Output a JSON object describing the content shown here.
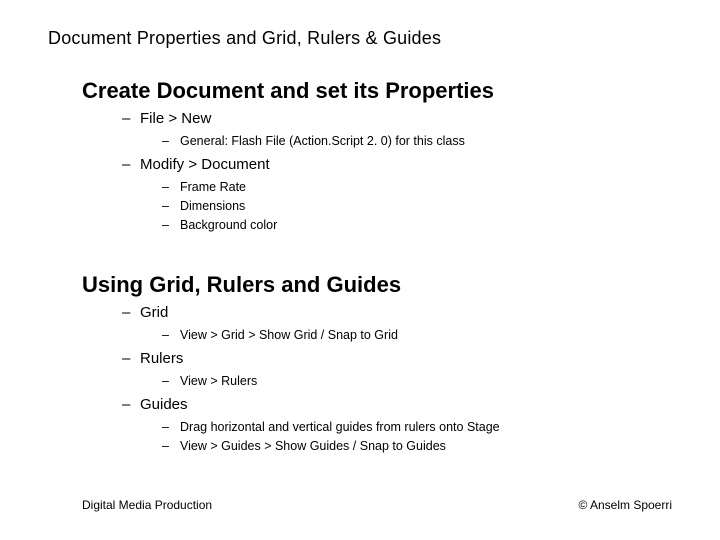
{
  "title": "Document Properties and Grid, Rulers & Guides",
  "section1": {
    "heading": "Create Document and set its Properties",
    "items": [
      {
        "label": "File > New",
        "sub": [
          "General: Flash File (Action.Script 2. 0) for this class"
        ]
      },
      {
        "label": "Modify > Document",
        "sub": [
          "Frame Rate",
          "Dimensions",
          "Background color"
        ]
      }
    ]
  },
  "section2": {
    "heading": "Using Grid, Rulers and Guides",
    "items": [
      {
        "label": "Grid",
        "sub": [
          "View > Grid > Show Grid / Snap to Grid"
        ]
      },
      {
        "label": "Rulers",
        "sub": [
          "View > Rulers"
        ]
      },
      {
        "label": "Guides",
        "sub": [
          "Drag horizontal and vertical guides from rulers onto Stage",
          "View > Guides > Show Guides / Snap to Guides"
        ]
      }
    ]
  },
  "footer": {
    "left": "Digital Media Production",
    "right": "© Anselm Spoerri"
  }
}
